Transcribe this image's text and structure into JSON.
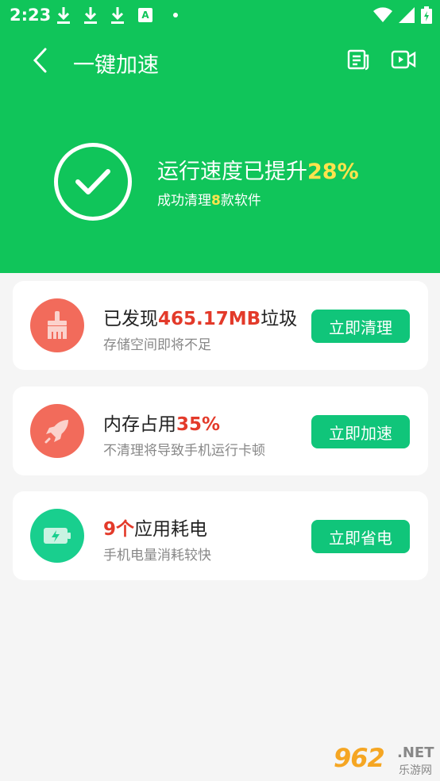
{
  "status_bar": {
    "time": "2:23",
    "indicator_letter": "A"
  },
  "app_bar": {
    "title": "一键加速"
  },
  "result": {
    "title_prefix": "运行速度已提升",
    "title_value": "28%",
    "sub_prefix": "成功清理",
    "sub_value": "8",
    "sub_suffix": "款软件"
  },
  "cards": [
    {
      "icon": "broom-icon",
      "title_prefix": "已发现",
      "title_value": "465.17MB",
      "title_suffix": "垃圾",
      "subtitle": "存储空间即将不足",
      "button": "立即清理",
      "icon_color": "#f26b5b"
    },
    {
      "icon": "rocket-icon",
      "title_prefix": "内存占用",
      "title_value": "35%",
      "title_suffix": "",
      "subtitle": "不清理将导致手机运行卡顿",
      "button": "立即加速",
      "icon_color": "#f26b5b"
    },
    {
      "icon": "battery-icon",
      "title_prefix": "",
      "title_value": "9个",
      "title_suffix": "应用耗电",
      "subtitle": "手机电量消耗较快",
      "button": "立即省电",
      "icon_color": "#19cf8e"
    }
  ],
  "watermark": {
    "main": "962",
    "net": ".NET",
    "sub": "乐游网"
  },
  "colors": {
    "primary_green": "#10c55a",
    "button_green": "#10c57a",
    "highlight_yellow": "#ffe34d",
    "highlight_red": "#e33a2a"
  }
}
